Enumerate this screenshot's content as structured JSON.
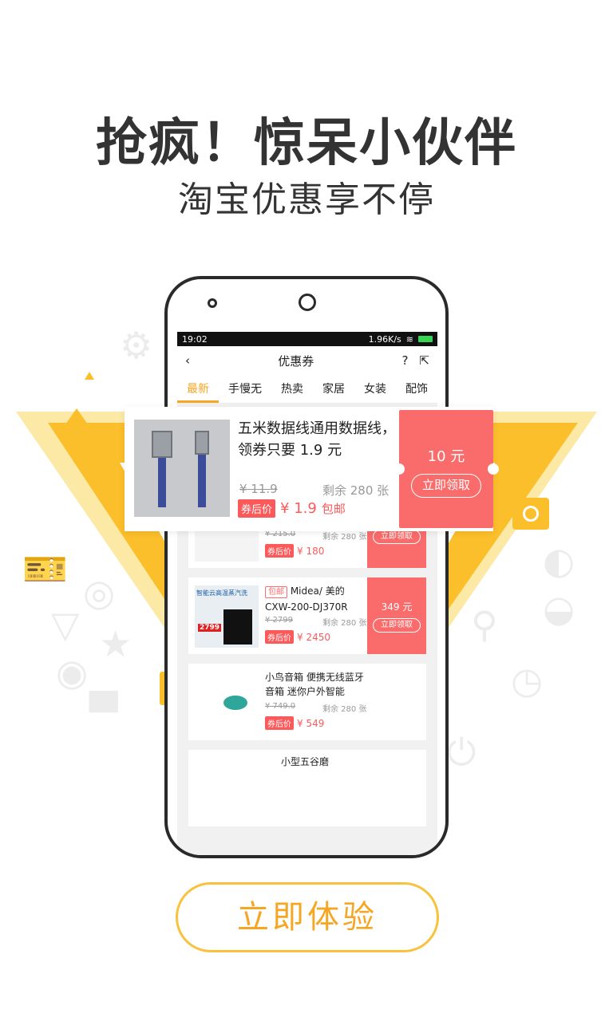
{
  "hero": {
    "headline": "抢疯！惊呆小伙伴",
    "subline": "淘宝优惠享不停"
  },
  "colors": {
    "accent": "#f5a623",
    "coupon_red": "#fa6b6b",
    "price_red": "#fc5a5a",
    "triangle_yellow": "#fbbf2c",
    "triangle_light": "#fde9a6"
  },
  "phone": {
    "status": {
      "time": "19:02",
      "speed": "1.96K/s"
    },
    "nav": {
      "back_icon": "back-arrow-icon",
      "title": "优惠券",
      "help_icon": "help-icon",
      "share_icon": "share-icon"
    },
    "tabs": [
      {
        "label": "最新",
        "active": true
      },
      {
        "label": "手慢无"
      },
      {
        "label": "热卖"
      },
      {
        "label": "家居"
      },
      {
        "label": "女装"
      },
      {
        "label": "配饰"
      }
    ],
    "cards": [
      {
        "orig": "¥ 215.0",
        "remain": "剩余 280 张",
        "tag": "券后价",
        "price": "¥ 180",
        "btn": "立即领取"
      },
      {
        "title_badge": "包邮",
        "title": "Midea/ 美的 CXW-200-DJ370R",
        "thumb_label": "智能云高温蒸汽洗",
        "thumb_price": "2799",
        "orig": "¥ 2799",
        "remain": "剩余 280 张",
        "tag": "券后价",
        "price": "¥ 2450",
        "amount": "349 元",
        "btn": "立即领取"
      },
      {
        "title": "小鸟音箱 便携无线蓝牙音箱 迷你户外智能",
        "orig": "¥ 749.0",
        "remain": "剩余 280 张",
        "tag": "券后价",
        "price": "¥ 549"
      },
      {
        "title": "小型五谷磨"
      }
    ]
  },
  "popup": {
    "title": "五米数据线通用数据线，领券只要 1.9 元",
    "orig": "¥ 11.9",
    "remain": "剩余 280 张",
    "tag": "券后价",
    "price": "¥ 1.9",
    "free_shipping": "包邮",
    "amount": "10 元",
    "btn": "立即领取"
  },
  "ticket_symbol": "¥",
  "cta": {
    "label": "立即体验"
  }
}
